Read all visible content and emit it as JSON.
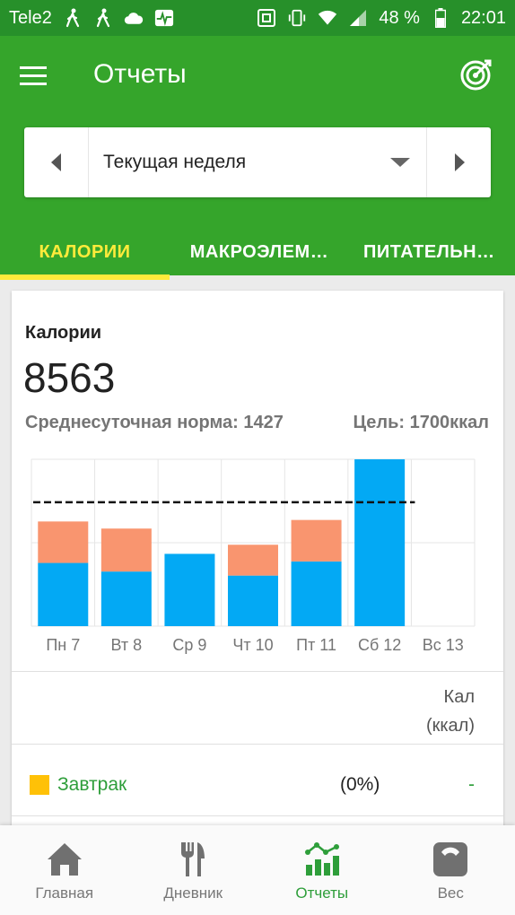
{
  "status_bar": {
    "carrier": "Tele2",
    "battery": "48 %",
    "time": "22:01"
  },
  "app_bar": {
    "title": "Отчеты"
  },
  "week_selector": {
    "label": "Текущая неделя"
  },
  "tabs": [
    {
      "label": "КАЛОРИИ",
      "active": true
    },
    {
      "label": "МАКРОЭЛЕМ…",
      "active": false
    },
    {
      "label": "ПИТАТЕЛЬН…",
      "active": false
    }
  ],
  "summary": {
    "title": "Калории",
    "total": "8563",
    "avg_label": "Среднесуточная норма: 1427",
    "goal_label": "Цель: 1700ккал"
  },
  "chart_data": {
    "type": "bar",
    "categories": [
      "Пн 7",
      "Вт 8",
      "Ср 9",
      "Чт 10",
      "Пт 11",
      "Сб 12",
      "Вс 13"
    ],
    "series": [
      {
        "values": [
          1250,
          1080,
          1430,
          1000,
          1280,
          3300,
          0
        ]
      },
      {
        "values": [
          820,
          850,
          0,
          610,
          820,
          0,
          0
        ]
      }
    ],
    "goal_line": 2450,
    "ylim": [
      0,
      3300
    ],
    "colors": [
      "#03a9f4",
      "#f9956f"
    ],
    "goal_color": "#111111"
  },
  "table": {
    "column_header_line1": "Кал",
    "column_header_line2": "(ккал)",
    "rows": [
      {
        "label": "Завтрак",
        "percent": "(0%)",
        "value": "-",
        "color": "#ffc107"
      }
    ]
  },
  "bottom_nav": [
    {
      "label": "Главная",
      "icon": "home-icon",
      "active": false
    },
    {
      "label": "Дневник",
      "icon": "fork-knife-icon",
      "active": false
    },
    {
      "label": "Отчеты",
      "icon": "chart-icon",
      "active": true
    },
    {
      "label": "Вес",
      "icon": "scale-icon",
      "active": false
    }
  ],
  "colors": {
    "statusbar": "#27902a",
    "appbar": "#35a52b",
    "accent": "#ffeb3b",
    "green_text": "#2e9e3a"
  }
}
